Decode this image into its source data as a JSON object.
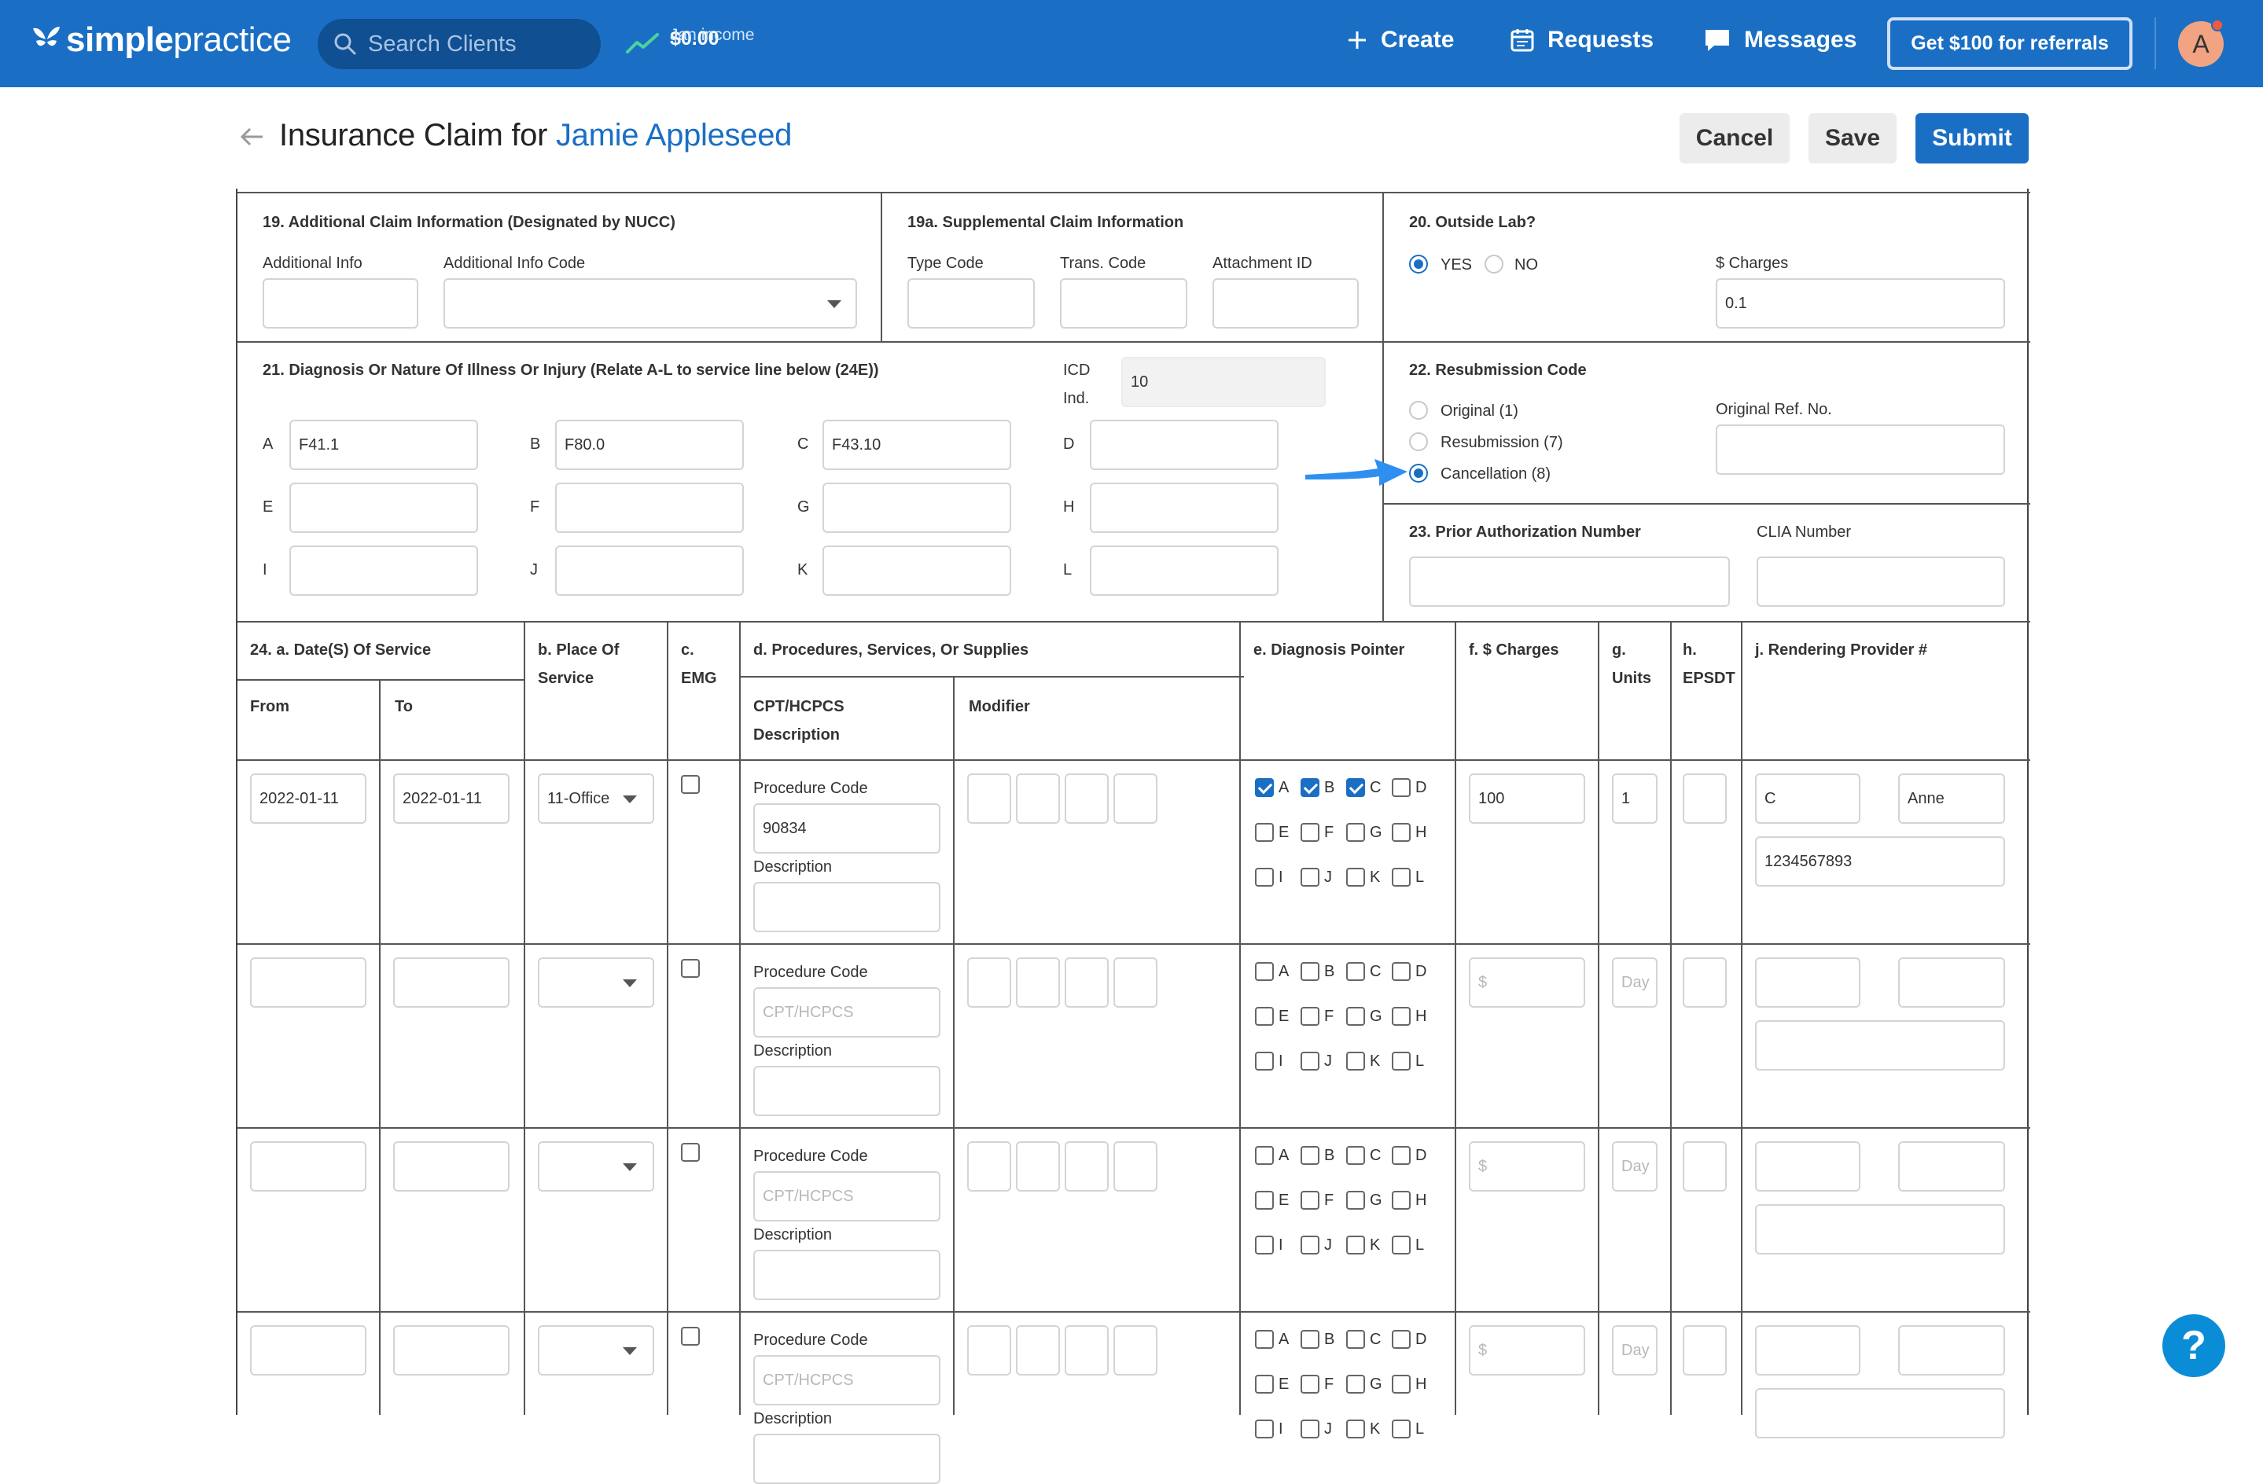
{
  "brand": {
    "name_bold": "simple",
    "name_light": "practice"
  },
  "nav": {
    "search_placeholder": "Search Clients",
    "income_label": "Jan income",
    "income_value": "$0.00",
    "create": "Create",
    "requests": "Requests",
    "messages": "Messages",
    "referral": "Get $100 for referrals",
    "avatar_initial": "A"
  },
  "page": {
    "title_prefix": "Insurance Claim for",
    "client_name": "Jamie Appleseed",
    "cancel": "Cancel",
    "save": "Save",
    "submit": "Submit"
  },
  "box19": {
    "title": "19. Additional Claim Information (Designated by NUCC)",
    "additional_info_label": "Additional Info",
    "additional_info_code_label": "Additional Info Code"
  },
  "box19a": {
    "title": "19a. Supplemental Claim Information",
    "type_code_label": "Type Code",
    "trans_code_label": "Trans. Code",
    "attachment_id_label": "Attachment ID"
  },
  "box20": {
    "title": "20. Outside Lab?",
    "yes": "YES",
    "no": "NO",
    "charges_label": "$ Charges",
    "charges_value": "0.1",
    "selected": "YES"
  },
  "box21": {
    "title": "21. Diagnosis Or Nature Of Illness Or Injury (Relate A-L to service line below (24E))",
    "icd_label_1": "ICD",
    "icd_label_2": "Ind.",
    "icd_value": "10",
    "codes": [
      {
        "letter": "A",
        "value": "F41.1"
      },
      {
        "letter": "B",
        "value": "F80.0"
      },
      {
        "letter": "C",
        "value": "F43.10"
      },
      {
        "letter": "D",
        "value": ""
      },
      {
        "letter": "E",
        "value": ""
      },
      {
        "letter": "F",
        "value": ""
      },
      {
        "letter": "G",
        "value": ""
      },
      {
        "letter": "H",
        "value": ""
      },
      {
        "letter": "I",
        "value": ""
      },
      {
        "letter": "J",
        "value": ""
      },
      {
        "letter": "K",
        "value": ""
      },
      {
        "letter": "L",
        "value": ""
      }
    ]
  },
  "box22": {
    "title": "22. Resubmission Code",
    "options": [
      "Original (1)",
      "Resubmission (7)",
      "Cancellation (8)"
    ],
    "selected": "Cancellation (8)",
    "original_ref_label": "Original Ref. No."
  },
  "box23": {
    "title": "23. Prior Authorization Number",
    "clia_label": "CLIA Number"
  },
  "box24": {
    "date_header": "24. a. Date(S) Of Service",
    "from": "From",
    "to": "To",
    "place_header_1": "b. Place Of",
    "place_header_2": "Service",
    "emg_header_1": "c.",
    "emg_header_2": "EMG",
    "proc_header": "d. Procedures, Services, Or Supplies",
    "cpt_header_1": "CPT/HCPCS",
    "cpt_header_2": "Description",
    "modifier_header": "Modifier",
    "diag_header": "e. Diagnosis Pointer",
    "charges_header": "f. $ Charges",
    "units_header_1": "g.",
    "units_header_2": "Units",
    "epsdt_header_1": "h.",
    "epsdt_header_2": "EPSDT",
    "provider_header": "j. Rendering Provider #",
    "procedure_code_label": "Procedure Code",
    "description_label": "Description",
    "cpt_placeholder": "CPT/HCPCS",
    "charges_placeholder": "$",
    "units_placeholder": "Day",
    "pointer_letters": [
      "A",
      "B",
      "C",
      "D",
      "E",
      "F",
      "G",
      "H",
      "I",
      "J",
      "K",
      "L"
    ],
    "rows": [
      {
        "from": "2022-01-11",
        "to": "2022-01-11",
        "place": "11-Office",
        "procedure_code": "90834",
        "charges": "100",
        "units": "1",
        "provider_qual": "C",
        "provider_name": "Anne",
        "provider_npi": "1234567893",
        "pointers": [
          "A",
          "B",
          "C"
        ]
      },
      {
        "from": "",
        "to": "",
        "place": "",
        "procedure_code": "",
        "charges": "",
        "units": "",
        "provider_qual": "",
        "provider_name": "",
        "provider_npi": "",
        "pointers": []
      },
      {
        "from": "",
        "to": "",
        "place": "",
        "procedure_code": "",
        "charges": "",
        "units": "",
        "provider_qual": "",
        "provider_name": "",
        "provider_npi": "",
        "pointers": []
      },
      {
        "from": "",
        "to": "",
        "place": "",
        "procedure_code": "",
        "charges": "",
        "units": "",
        "provider_qual": "",
        "provider_name": "",
        "provider_npi": "",
        "pointers": []
      }
    ]
  },
  "help": {
    "label": "?"
  },
  "colors": {
    "brand_blue": "#1a6fc4",
    "annotation_arrow": "#2f8ff0"
  }
}
